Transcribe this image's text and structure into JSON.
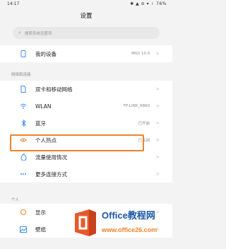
{
  "status_bar": {
    "time": "14:17",
    "icons": "✱ ▲ ⊘ ▾ ⏽ 76%"
  },
  "header": {
    "title": "设置"
  },
  "search": {
    "placeholder": "搜索系统设置项"
  },
  "device": {
    "label": "我的设备",
    "value": "MIUI 10.0"
  },
  "section_network": {
    "title": "网络和连接"
  },
  "network_items": [
    {
      "label": "双卡和移动网络",
      "value": ""
    },
    {
      "label": "WLAN",
      "value": "TP-LINK_6860"
    },
    {
      "label": "蓝牙",
      "value": "已开启"
    },
    {
      "label": "个人热点",
      "value": "已关闭"
    },
    {
      "label": "流量使用情况",
      "value": ""
    },
    {
      "label": "更多连接方式",
      "value": ""
    }
  ],
  "section_personal": {
    "title": "个人"
  },
  "personal_items": [
    {
      "label": "显示",
      "value": ""
    },
    {
      "label": "壁纸",
      "value": ""
    }
  ],
  "watermark": {
    "title": "Office教程网",
    "url": "www.office26.com"
  },
  "colors": {
    "highlight": "#f08326",
    "watermark_blue": "#1d58a6"
  }
}
